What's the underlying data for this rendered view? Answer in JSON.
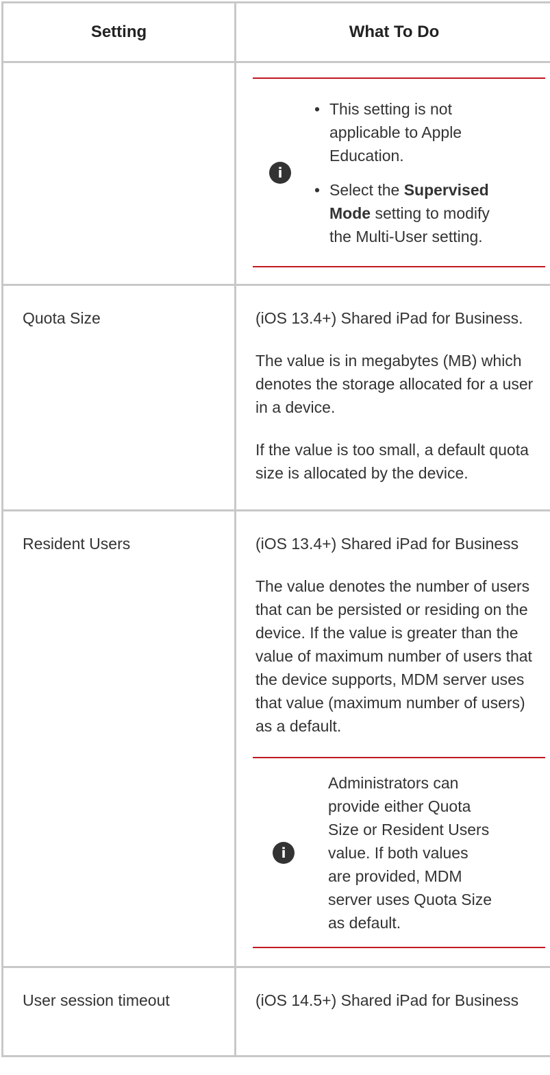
{
  "table": {
    "header": {
      "setting": "Setting",
      "what_to_do": "What To Do"
    },
    "row1_note": {
      "bullet1": "This setting is not applicable to Apple Education.",
      "bullet2_pre": "Select the ",
      "bullet2_bold": "Supervised Mode",
      "bullet2_post": " setting to modify the Multi-User setting."
    },
    "quota": {
      "name": "Quota Size",
      "p1": "(iOS 13.4+) Shared iPad for Business.",
      "p2": "The value is in megabytes (MB) which denotes the storage allocated for a user in a device.",
      "p3": "If the value is too small, a default quota size is allocated by the device."
    },
    "resident": {
      "name": "Resident Users",
      "p1": "(iOS 13.4+) Shared iPad for Business",
      "p2": "The value denotes the number of users that can be persisted or residing on the device. If the value is greater than the value of maximum number of users that the device supports, MDM server uses that value (maximum number of users) as a default.",
      "note": "Administrators can provide either Quota Size or Resident Users value. If both values are provided, MDM server uses Quota Size as default."
    },
    "session": {
      "name": "User session timeout",
      "p1": "(iOS 14.5+) Shared iPad for Business"
    }
  }
}
